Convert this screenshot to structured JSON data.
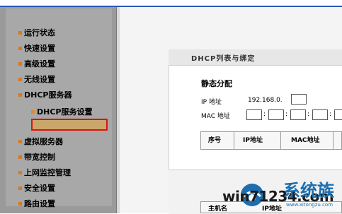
{
  "sidebar": {
    "items": [
      {
        "label": "运行状态"
      },
      {
        "label": "快速设置"
      },
      {
        "label": "高级设置"
      },
      {
        "label": "无线设置"
      },
      {
        "label": "DHCP服务器"
      },
      {
        "label": "DHCP服务设置"
      },
      {
        "label": ""
      },
      {
        "label": "虚拟服务器"
      },
      {
        "label": "带宽控制"
      },
      {
        "label": "上网监控管理"
      },
      {
        "label": "安全设置"
      },
      {
        "label": "路由设置"
      }
    ],
    "accent": "#d97a1a",
    "highlight_border": "#e01010"
  },
  "panel": {
    "title": "DHCP列表与绑定",
    "static": {
      "heading": "静态分配",
      "ip_label": "IP 地址",
      "ip_prefix": "192.168.0.",
      "mac_label": "MAC 地址",
      "mac_sep": ":"
    },
    "table": {
      "headers": [
        "序号",
        "IP地址",
        "MAC地址"
      ]
    },
    "bottom_table": {
      "headers": [
        "主机名",
        "IP地址"
      ]
    }
  },
  "watermark": {
    "text": "win71234.com",
    "cn": "系统族",
    "url": "www.xitongzu.com"
  }
}
